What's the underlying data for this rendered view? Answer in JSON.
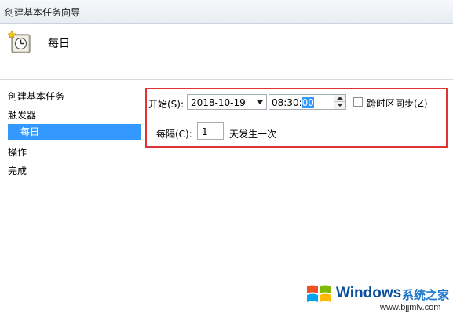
{
  "window": {
    "title": "创建基本任务向导"
  },
  "header": {
    "title": "每日",
    "icon": "clock-icon"
  },
  "nav": {
    "items": [
      {
        "label": "创建基本任务"
      },
      {
        "label": "触发器"
      },
      {
        "label": "每日",
        "selected": true
      },
      {
        "label": "操作"
      },
      {
        "label": "完成"
      }
    ]
  },
  "form": {
    "start_label": "开始(S):",
    "start_date": "2018-10-19",
    "start_time_prefix": "08:30:",
    "start_time_selected": "00",
    "sync_label": "跨时区同步(Z)",
    "sync_checked": false,
    "every_label": "每隔(C):",
    "every_value": "1",
    "every_suffix": "天发生一次"
  },
  "watermark": {
    "brand": "Windows",
    "site_cn": "系统之家",
    "site_url": "www.bjjmlv.com"
  },
  "colors": {
    "selection": "#3399ff",
    "highlight_border": "#e03434"
  }
}
